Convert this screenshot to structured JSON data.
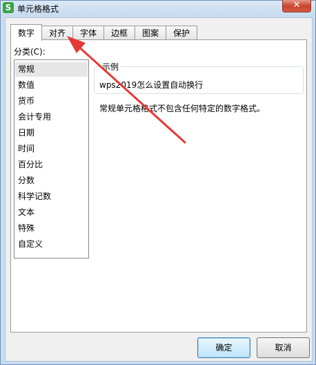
{
  "window": {
    "title": "单元格格式",
    "app_icon_letter": "S",
    "close_glyph": "✕"
  },
  "tabs": [
    {
      "label": "数字",
      "active": true
    },
    {
      "label": "对齐",
      "active": false
    },
    {
      "label": "字体",
      "active": false
    },
    {
      "label": "边框",
      "active": false
    },
    {
      "label": "图案",
      "active": false
    },
    {
      "label": "保护",
      "active": false
    }
  ],
  "category": {
    "label": "分类(C):",
    "selected": "常规",
    "items": [
      "常规",
      "数值",
      "货币",
      "会计专用",
      "日期",
      "时间",
      "百分比",
      "分数",
      "科学记数",
      "文本",
      "特殊",
      "自定义"
    ]
  },
  "sample": {
    "legend": "示例",
    "value": "wps2019怎么设置自动换行"
  },
  "description": "常规单元格格式不包含任何特定的数字格式。",
  "buttons": {
    "ok": "确定",
    "cancel": "取消"
  },
  "colors": {
    "annotation_arrow": "#e53935",
    "app_icon": "#3aa347"
  }
}
